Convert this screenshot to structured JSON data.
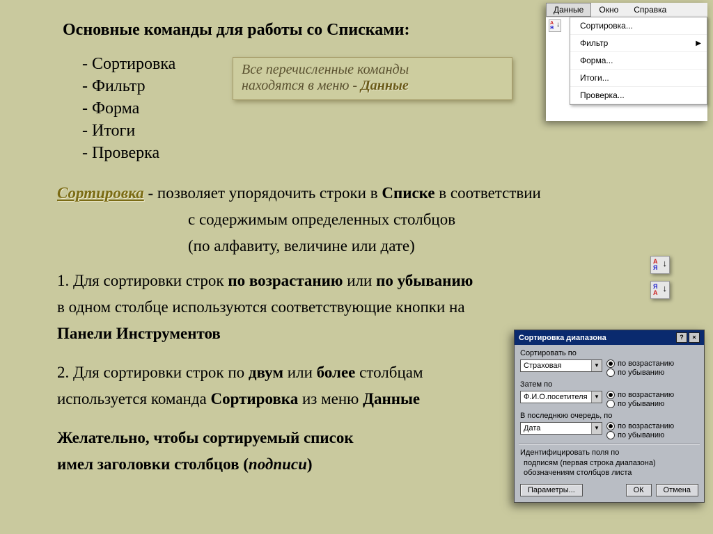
{
  "title": "Основные команды для работы со Списками:",
  "commands": {
    "c1": "- Сортировка",
    "c2": "- Фильтр",
    "c3": "- Форма",
    "c4": "- Итоги",
    "c5": "- Проверка"
  },
  "note": {
    "line1": "Все перечисленные команды",
    "line2_a": "находятся в меню - ",
    "line2_b": "Данные"
  },
  "para": {
    "sort_head": "Сортировка",
    "sort_tail": " - позволяет упорядочить строки в ",
    "sort_bold1": "Списке",
    "sort_tail2": " в соответствии",
    "line2": "с содержимым   определенных столбцов",
    "line3": "(по алфавиту, величине или дате)",
    "p1_a": "1. Для сортировки строк ",
    "p1_b": "по возрастанию",
    "p1_c": " или ",
    "p1_d": "по убыванию",
    "p1_line2": "в одном столбце используются соответствующие кнопки на",
    "p1_line3": " Панели Инструментов",
    "p2_a": "2. Для сортировки строк по ",
    "p2_b": "двум",
    "p2_c": " или ",
    "p2_d": "более",
    "p2_e": " столбцам",
    "p2_line2a": "используется команда ",
    "p2_line2b": "Сортировка",
    "p2_line2c": " из меню ",
    "p2_line2d": "Данные",
    "p3_a": "Желательно, чтобы сортируемый список",
    "p3_b": "имел заголовки столбцов (",
    "p3_c": "подписи",
    "p3_d": ")"
  },
  "menu": {
    "bar": {
      "data": "Данные",
      "window": "Окно",
      "help": "Справка"
    },
    "items": {
      "sort": "Сортировка...",
      "filter": "Фильтр",
      "form": "Форма...",
      "totals": "Итоги...",
      "check": "Проверка..."
    }
  },
  "toolbar_icons": {
    "a": "А",
    "z": "Я"
  },
  "dialog": {
    "title": "Сортировка диапазона",
    "help": "?",
    "close": "×",
    "group1": "Сортировать по",
    "sel1": "Страховая",
    "group2": "Затем по",
    "sel2": "Ф.И.О.посетителя",
    "group3": "В последнюю очередь, по",
    "sel3": "Дата",
    "r_asc": "по возрастанию",
    "r_desc": "по убыванию",
    "ident_label": "Идентифицировать поля по",
    "ident_opt1": "подписям (первая строка диапазона)",
    "ident_opt2": "обозначениям столбцов листа",
    "btn_params": "Параметры...",
    "btn_ok": "ОК",
    "btn_cancel": "Отмена"
  }
}
